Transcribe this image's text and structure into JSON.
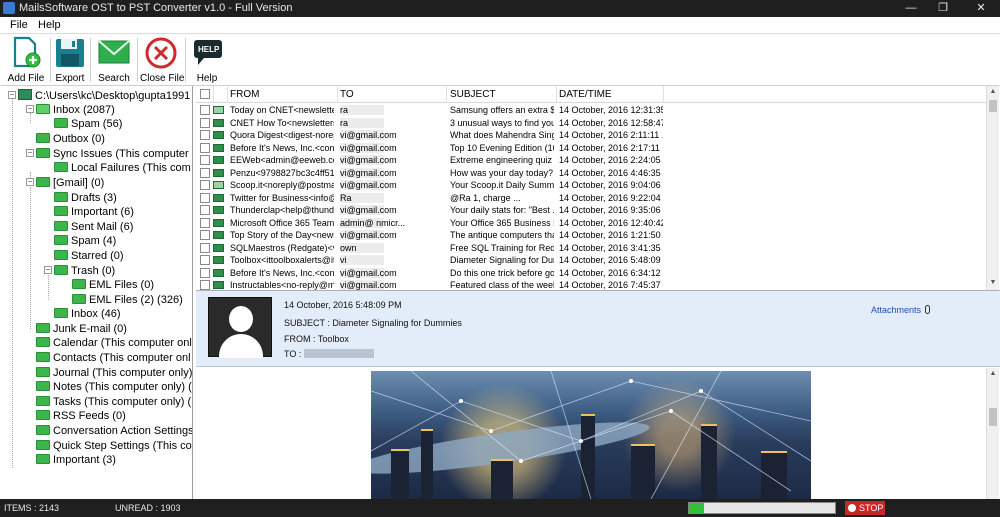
{
  "window": {
    "title": "MailsSoftware OST to PST Converter v1.0 - Full Version",
    "minimize": "—",
    "maximize": "❐",
    "close": "✕"
  },
  "menu": {
    "file": "File",
    "help": "Help"
  },
  "toolbar": {
    "add_file": "Add File",
    "export": "Export",
    "search": "Search",
    "close_file": "Close File",
    "help": "Help",
    "help_badge": "HELP"
  },
  "tree": {
    "root": "C:\\Users\\kc\\Desktop\\gupta1991",
    "nodes": [
      {
        "label": "Inbox (2087)"
      },
      {
        "label": "Spam (56)"
      },
      {
        "label": "Outbox (0)"
      },
      {
        "label": "Sync Issues (This computer"
      },
      {
        "label": "Local Failures (This com"
      },
      {
        "label": "[Gmail] (0)"
      },
      {
        "label": "Drafts (3)"
      },
      {
        "label": "Important (6)"
      },
      {
        "label": "Sent Mail (6)"
      },
      {
        "label": "Spam (4)"
      },
      {
        "label": "Starred (0)"
      },
      {
        "label": "Trash (0)"
      },
      {
        "label": "EML Files (0)"
      },
      {
        "label": "EML Files (2) (326)"
      },
      {
        "label": "Inbox (46)"
      },
      {
        "label": "Junk E-mail (0)"
      },
      {
        "label": "Calendar (This computer onl"
      },
      {
        "label": "Contacts (This computer onl"
      },
      {
        "label": "Journal (This computer only)"
      },
      {
        "label": "Notes (This computer only) ("
      },
      {
        "label": "Tasks (This computer only) ("
      },
      {
        "label": "RSS Feeds (0)"
      },
      {
        "label": "Conversation Action Settings"
      },
      {
        "label": "Quick Step Settings (This co"
      },
      {
        "label": "Important (3)"
      }
    ]
  },
  "grid": {
    "columns": {
      "from": "FROM",
      "to": "TO",
      "subject": "SUBJECT",
      "date": "DATE/TIME"
    },
    "rows": [
      {
        "from": "Today on CNET<newslette...",
        "to": "ra",
        "subject": "Samsung offers an extra $1...",
        "date": "14 October, 2016 12:31:35..."
      },
      {
        "from": "CNET How To<newsletters...",
        "to": "ra",
        "subject": "3 unusual ways to find your...",
        "date": "14 October, 2016 12:58:47..."
      },
      {
        "from": "Quora Digest<digest-norepl...",
        "to": "vi@gmail.com",
        "subject": "What does Mahendra Sing...",
        "date": "14 October, 2016 2:11:11 ..."
      },
      {
        "from": "Before It's News, Inc.<cont...",
        "to": "vi@gmail.com",
        "subject": "Top 10 Evening Edition (10...",
        "date": "14 October, 2016 2:17:11 ..."
      },
      {
        "from": "EEWeb<admin@eeweb.co...",
        "to": "vi@gmail.com",
        "subject": "Extreme engineering quiz | ...",
        "date": "14 October, 2016 2:24:05 ..."
      },
      {
        "from": "Penzu<9798827bc3c4ff51...",
        "to": "vi@gmail.com",
        "subject": "How was your day today?",
        "date": "14 October, 2016 4:46:35 ..."
      },
      {
        "from": "Scoop.it<noreply@postmas...",
        "to": "vi@gmail.com",
        "subject": "Your Scoop.it Daily Summary",
        "date": "14 October, 2016 9:04:06 ..."
      },
      {
        "from": "Twitter for Business<info@t...",
        "to": "Ra",
        "subject": "@Ra             1, charge ...",
        "date": "14 October, 2016 9:22:04 ..."
      },
      {
        "from": "Thunderclap<help@thund...",
        "to": "vi@gmail.com",
        "subject": "Your daily stats for: \"Best ...",
        "date": "14 October, 2016 9:35:06 ..."
      },
      {
        "from": "Microsoft Office 365 Team...",
        "to": "admin@       nmicr...",
        "subject": "Your Office 365 Business P...",
        "date": "14 October, 2016 12:40:42..."
      },
      {
        "from": "Top Story of the Day<news...",
        "to": "vi@gmail.com",
        "subject": "The antique computers tha...",
        "date": "14 October, 2016 1:21:50 ..."
      },
      {
        "from": "SQLMaestros (Redgate)<vi...",
        "to": "own",
        "subject": "Free SQL Training for Red...",
        "date": "14 October, 2016 3:41:35 ..."
      },
      {
        "from": "Toolbox<ittoolboxalerts@itt...",
        "to": "vi",
        "subject": "Diameter Signaling for Dum...",
        "date": "14 October, 2016 5:48:09 ..."
      },
      {
        "from": "Before It's News, Inc.<cont...",
        "to": "vi@gmail.com",
        "subject": "Do this one trick before goi...",
        "date": "14 October, 2016 6:34:12 ..."
      },
      {
        "from": "Instructables<no-reply@ma...",
        "to": "vi@gmail.com",
        "subject": "Featured class of the week...",
        "date": "14 October, 2016 7:45:37 ..."
      }
    ]
  },
  "preview": {
    "date": "14 October, 2016 5:48:09 PM",
    "subject": "SUBJECT : Diameter Signaling for Dummies",
    "from": "FROM : Toolbox",
    "to": "TO :",
    "attachments": "Attachments"
  },
  "status": {
    "items": "ITEMS : 2143",
    "unread": "UNREAD : 1903",
    "progress_fraction": 0.1,
    "stop": "STOP"
  },
  "colors": {
    "folder": "#3cb64a",
    "preview_bg": "#e3edf9",
    "stop": "#c62828",
    "progress": "#2fbf3a",
    "titlebar": "#1f1f1f"
  }
}
